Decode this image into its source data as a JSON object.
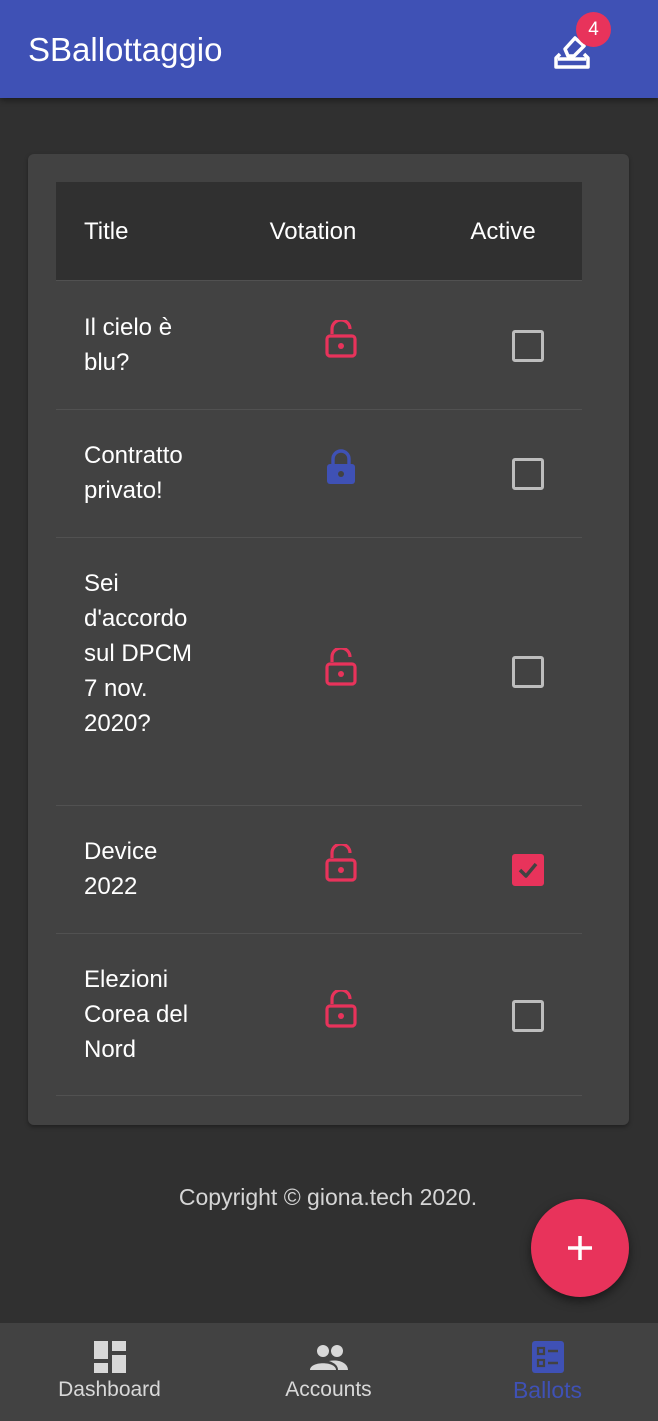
{
  "app": {
    "title": "SBallottaggio",
    "badge_count": "4",
    "colors": {
      "primary": "#3f51b5",
      "accent": "#e8335b",
      "background": "#303030",
      "card": "#424242"
    }
  },
  "table": {
    "headers": {
      "title": "Title",
      "votation": "Votation",
      "active": "Active"
    },
    "rows": [
      {
        "title": "Il cielo è blu?",
        "votation_icon": "lock-open-icon",
        "active": false
      },
      {
        "title": "Contratto privato!",
        "votation_icon": "lock-closed-icon",
        "active": false
      },
      {
        "title": "Sei d'accordo sul DPCM 7 nov. 2020?",
        "votation_icon": "lock-open-icon",
        "active": false
      },
      {
        "title": "Device 2022",
        "votation_icon": "lock-open-icon",
        "active": true
      },
      {
        "title": "Elezioni Corea del Nord",
        "votation_icon": "lock-open-icon",
        "active": false
      }
    ]
  },
  "footer": {
    "copyright": "Copyright © giona.tech 2020."
  },
  "fab": {
    "icon": "plus-icon"
  },
  "bottom_nav": {
    "items": [
      {
        "label": "Dashboard",
        "icon": "dashboard-icon",
        "active": false
      },
      {
        "label": "Accounts",
        "icon": "people-icon",
        "active": false
      },
      {
        "label": "Ballots",
        "icon": "ballot-list-icon",
        "active": true
      }
    ]
  }
}
